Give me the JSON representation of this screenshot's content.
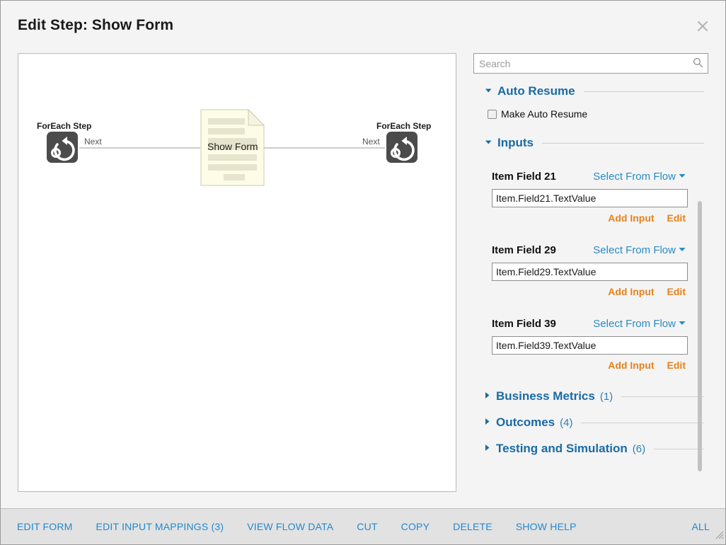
{
  "header": {
    "title": "Edit Step: Show Form",
    "close_icon": "close-icon"
  },
  "canvas": {
    "nodes": [
      {
        "label": "ForEach Step",
        "icon": "foreach-loop-icon",
        "type": "foreach"
      },
      {
        "label": "Show Form",
        "icon": "document-form-icon",
        "type": "form"
      },
      {
        "label": "ForEach Step",
        "icon": "foreach-loop-icon",
        "type": "foreach"
      }
    ],
    "edges": [
      {
        "label": "Next"
      },
      {
        "label": "Next"
      }
    ]
  },
  "panel": {
    "search": {
      "placeholder": "Search",
      "value": "",
      "icon": "search-icon"
    },
    "sections": [
      {
        "id": "auto-resume",
        "title": "Auto Resume",
        "expanded": true,
        "count": ""
      },
      {
        "id": "inputs",
        "title": "Inputs",
        "expanded": true,
        "count": ""
      },
      {
        "id": "business-metrics",
        "title": "Business Metrics",
        "expanded": false,
        "count": "(1)"
      },
      {
        "id": "outcomes",
        "title": "Outcomes",
        "expanded": false,
        "count": "(4)"
      },
      {
        "id": "testing-and-simulation",
        "title": "Testing and Simulation",
        "expanded": false,
        "count": "(6)"
      }
    ],
    "auto_resume": {
      "checkbox_label": "Make Auto Resume",
      "checked": false
    },
    "inputs": {
      "select_from_flow_label": "Select From Flow",
      "add_input_label": "Add Input",
      "edit_label": "Edit",
      "fields": [
        {
          "name": "Item Field 21",
          "value": "Item.Field21.TextValue"
        },
        {
          "name": "Item Field 29",
          "value": "Item.Field29.TextValue"
        },
        {
          "name": "Item Field 39",
          "value": "Item.Field39.TextValue"
        }
      ]
    }
  },
  "toolbar": {
    "items": [
      "EDIT FORM",
      "EDIT INPUT MAPPINGS (3)",
      "VIEW FLOW DATA",
      "CUT",
      "COPY",
      "DELETE",
      "SHOW HELP"
    ],
    "all_label": "ALL"
  },
  "colors": {
    "accent_blue": "#2389cd",
    "section_blue": "#1a6ba4",
    "link_orange": "#e8821a",
    "node_dark": "#4b4b4b",
    "doc_fill": "#fdfce6",
    "page_bg": "#f4f4f4",
    "toolbar_bg": "#e2e2e2"
  }
}
